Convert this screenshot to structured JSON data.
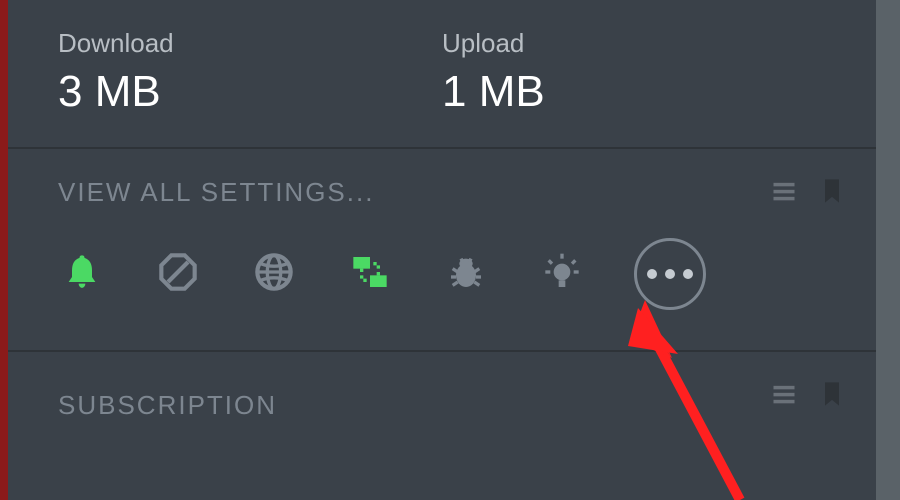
{
  "stats": {
    "download": {
      "label": "Download",
      "value": "3 MB"
    },
    "upload": {
      "label": "Upload",
      "value": "1 MB"
    }
  },
  "settings": {
    "title": "VIEW ALL SETTINGS..."
  },
  "subscription": {
    "title": "SUBSCRIPTION"
  },
  "colors": {
    "active_green": "#4bd964",
    "inactive_gray": "#7d8690"
  }
}
